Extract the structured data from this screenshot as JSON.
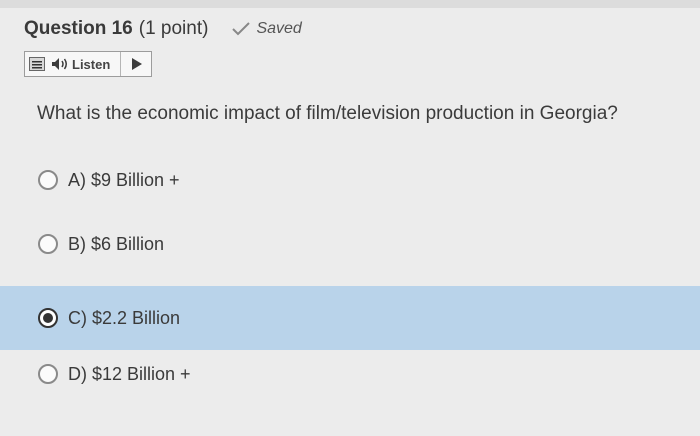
{
  "question": {
    "title": "Question 16",
    "points": "(1 point)",
    "saved_label": "Saved",
    "prompt": "What is the economic impact of film/television production in Georgia?"
  },
  "listen": {
    "label": "Listen",
    "icons": [
      "menu-icon",
      "speaker-icon",
      "play-icon"
    ]
  },
  "options": [
    {
      "label": "A) $9 Billion +",
      "selected": false
    },
    {
      "label": "B) $6 Billion",
      "selected": false
    },
    {
      "label": "C) $2.2 Billion",
      "selected": true
    },
    {
      "label": "D) $12 Billion +",
      "selected": false
    }
  ],
  "colors": {
    "selected_bg": "#b9d3ea",
    "page_bg": "#ececec",
    "text": "#3a3a3a"
  }
}
